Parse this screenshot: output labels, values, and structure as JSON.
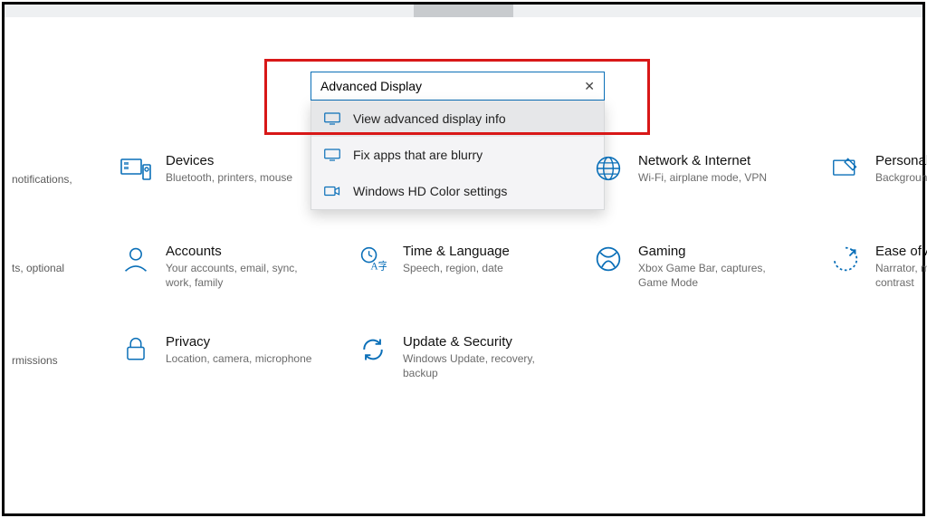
{
  "search": {
    "value": "Advanced Display",
    "clear": "✕",
    "suggestions": [
      {
        "icon": "monitor-icon",
        "label": "View advanced display info"
      },
      {
        "icon": "monitor-icon",
        "label": "Fix apps that are blurry"
      },
      {
        "icon": "camera-icon",
        "label": "Windows HD Color settings"
      }
    ]
  },
  "leftPartial": {
    "r1": "notifications,",
    "r2a": "ts, optional",
    "r3": "rmissions"
  },
  "tiles": {
    "devices": {
      "title": "Devices",
      "sub": "Bluetooth, printers, mouse"
    },
    "network": {
      "title": "Network & Internet",
      "sub": "Wi-Fi, airplane mode, VPN"
    },
    "personalize": {
      "title": "Personaliz",
      "sub": "Backgroun"
    },
    "accounts": {
      "title": "Accounts",
      "sub": "Your accounts, email, sync, work, family"
    },
    "time": {
      "title": "Time & Language",
      "sub": "Speech, region, date"
    },
    "gaming": {
      "title": "Gaming",
      "sub": "Xbox Game Bar, captures, Game Mode"
    },
    "ease": {
      "title": "Ease of A",
      "sub": "Narrator, m\ncontrast"
    },
    "privacy": {
      "title": "Privacy",
      "sub": "Location, camera, microphone"
    },
    "update": {
      "title": "Update & Security",
      "sub": "Windows Update, recovery, backup"
    }
  },
  "colors": {
    "accent": "#0a6fb8",
    "highlight": "#d81818"
  }
}
